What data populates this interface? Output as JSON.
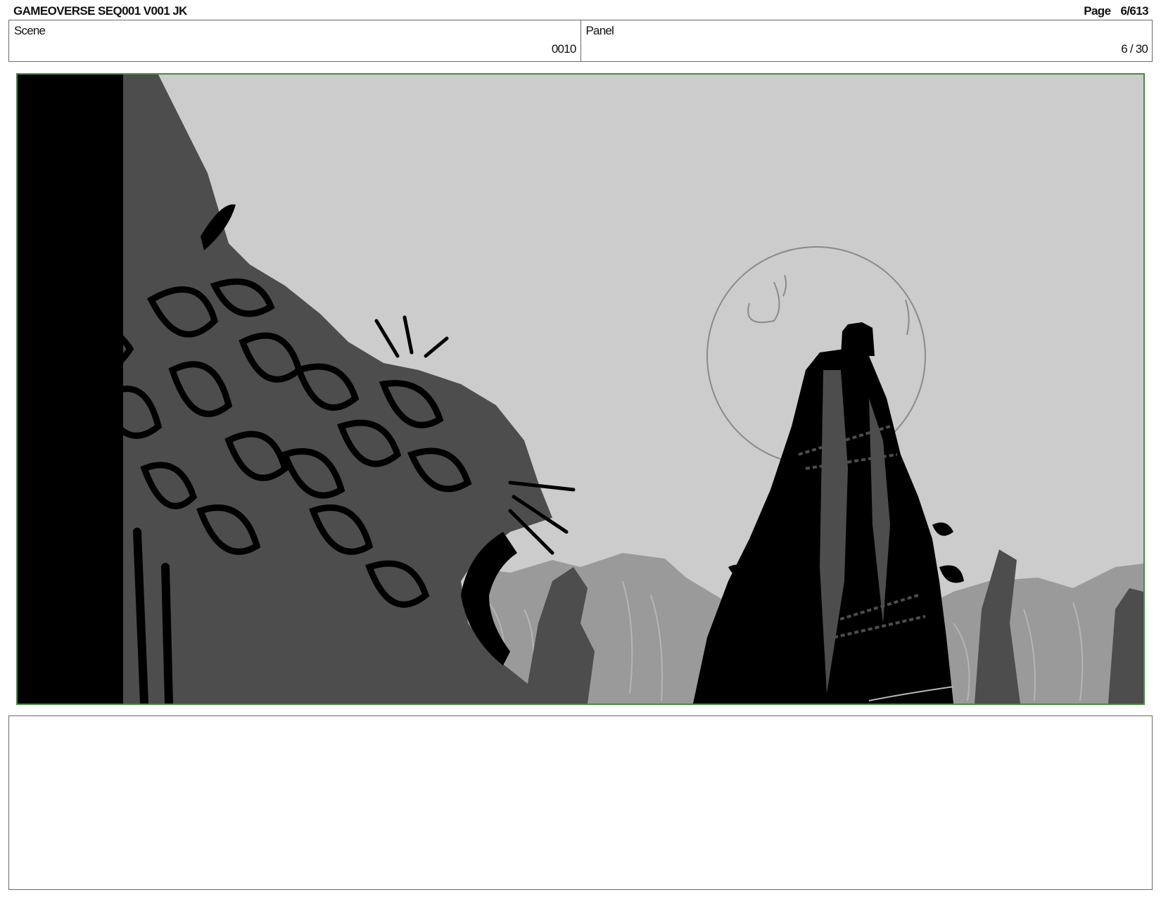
{
  "header": {
    "title": "GAMEOVERSE SEQ001 V001 JK",
    "page_label": "Page",
    "page_value": "6/613"
  },
  "info": {
    "scene_label": "Scene",
    "scene_value": "0010",
    "panel_label": "Panel",
    "panel_value": "6 / 30"
  },
  "frame": {
    "border_color": "#4a8a45",
    "sky_color": "#cccccc",
    "palette": [
      "#000000",
      "#4d4d4d",
      "#9a9a9a",
      "#b5b5b5"
    ]
  },
  "notes": {
    "text": ""
  }
}
